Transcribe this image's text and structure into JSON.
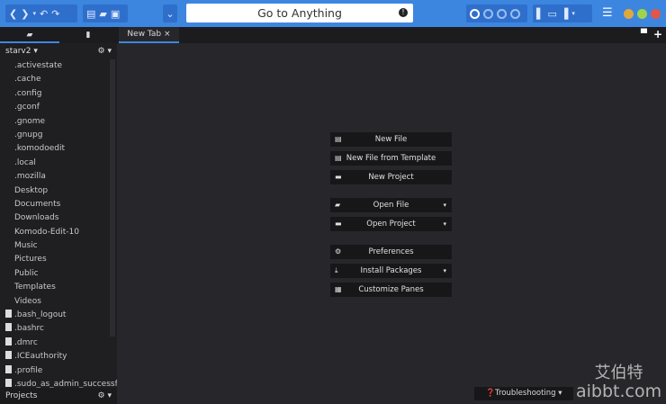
{
  "toolbar": {
    "goto_placeholder": "Go to Anything"
  },
  "tabs": {
    "new_tab": "New Tab",
    "close": "×"
  },
  "sidebar": {
    "project": "starv2 ▾",
    "items": [
      ".activestate",
      ".cache",
      ".config",
      ".gconf",
      ".gnome",
      ".gnupg",
      ".komodoedit",
      ".local",
      ".mozilla",
      "Desktop",
      "Documents",
      "Downloads",
      "Komodo-Edit-10",
      "Music",
      "Pictures",
      "Public",
      "Templates",
      "Videos"
    ],
    "files": [
      ".bash_logout",
      ".bashrc",
      ".dmrc",
      ".ICEauthority",
      ".profile",
      ".sudo_as_admin_successful"
    ],
    "projects_label": "Projects"
  },
  "start": {
    "buttons": [
      "New File",
      "New File from Template",
      "New Project",
      "Open File",
      "Open Project",
      "Preferences",
      "Install Packages",
      "Customize Panes"
    ]
  },
  "status": {
    "troubleshooting": "Troubleshooting"
  },
  "watermark": {
    "cn": "艾伯特",
    "url": "aibbt.com"
  }
}
